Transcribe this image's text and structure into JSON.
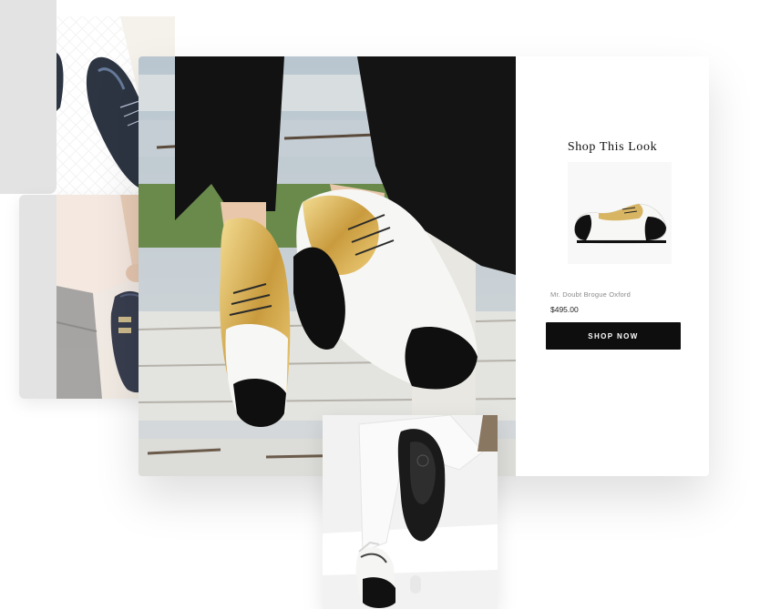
{
  "shop": {
    "title": "Shop This Look",
    "product_name": "Mr. Doubt Brogue Oxford",
    "product_price": "$495.00",
    "button_label": "SHOP NOW"
  },
  "colors": {
    "button_bg": "#0e0e0e",
    "button_text": "#ffffff",
    "card_grey": "#e3e3e3",
    "gold": "#c9a14a"
  },
  "images": {
    "top_left": "black-patent-brogue-on-tile-floor",
    "middle_left": "hand-holding-navy-monk-strap-shoes",
    "hero": "gold-white-black-wingtip-brogues-on-fence",
    "product": "white-gold-black-brogue-oxford",
    "bottom": "brogue-sole-with-bathtub"
  }
}
